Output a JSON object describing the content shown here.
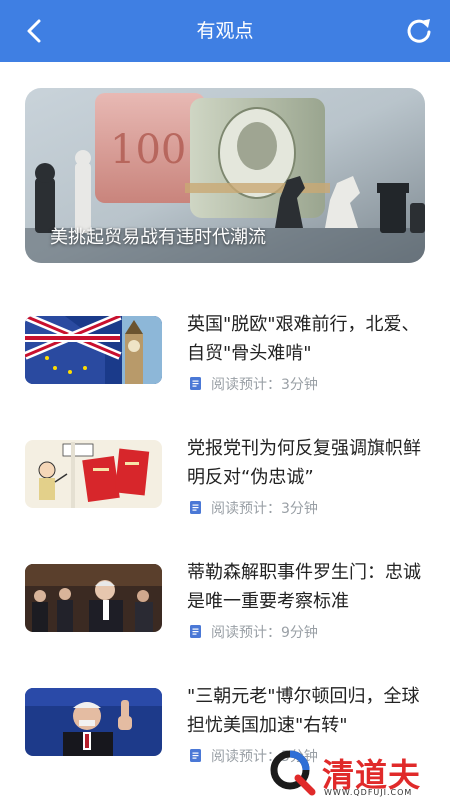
{
  "header": {
    "title": "有观点"
  },
  "hero": {
    "caption": "美挑起贸易战有违时代潮流"
  },
  "articles": [
    {
      "title": "英国\"脱欧\"艰难前行，北爱、自贸\"骨头难啃\"",
      "meta": "阅读预计：3分钟"
    },
    {
      "title": "党报党刊为何反复强调旗帜鲜明反对“伪忠诚”",
      "meta": "阅读预计：3分钟"
    },
    {
      "title": "蒂勒森解职事件罗生门：忠诚是唯一重要考察标准",
      "meta": "阅读预计：9分钟"
    },
    {
      "title": "\"三朝元老\"博尔顿回归，全球担忧美国加速\"右转\"",
      "meta": "阅读预计：5分钟"
    }
  ],
  "watermark": {
    "text": "清道夫",
    "url": "WWW.QDFUJI.COM"
  },
  "colors": {
    "header": "#3f7fe3",
    "meta": "#9aa0a6",
    "meta_icon": "#4a78d6",
    "watermark": "#e02a2a"
  }
}
